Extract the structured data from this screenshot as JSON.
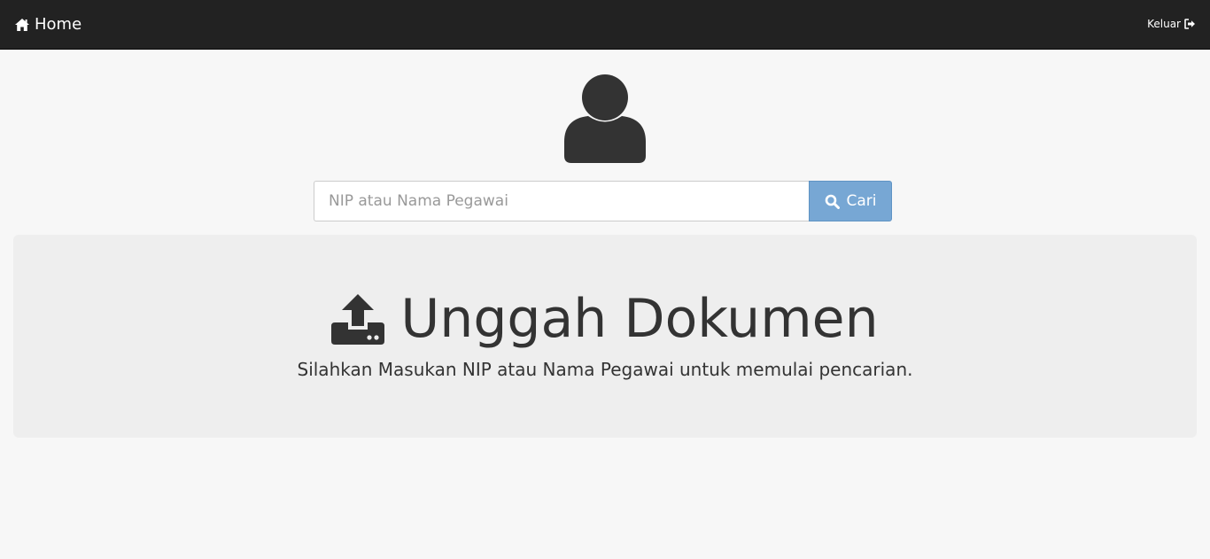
{
  "navbar": {
    "brand_label": "Home",
    "brand_icon": "home-icon",
    "logout_label": "Keluar",
    "logout_icon": "sign-out-icon"
  },
  "search": {
    "placeholder": "NIP atau Nama Pegawai",
    "value": "",
    "button_label": "Cari",
    "button_icon": "search-icon"
  },
  "jumbotron": {
    "title": "Unggah Dokumen",
    "title_icon": "upload-icon",
    "subtitle": "Silahkan Masukan NIP atau Nama Pegawai untuk memulai pencarian."
  },
  "colors": {
    "navbar_bg": "#222222",
    "button_bg": "#77a7d4",
    "jumbotron_bg": "#eeeeee",
    "page_bg": "#f7f7f7"
  }
}
